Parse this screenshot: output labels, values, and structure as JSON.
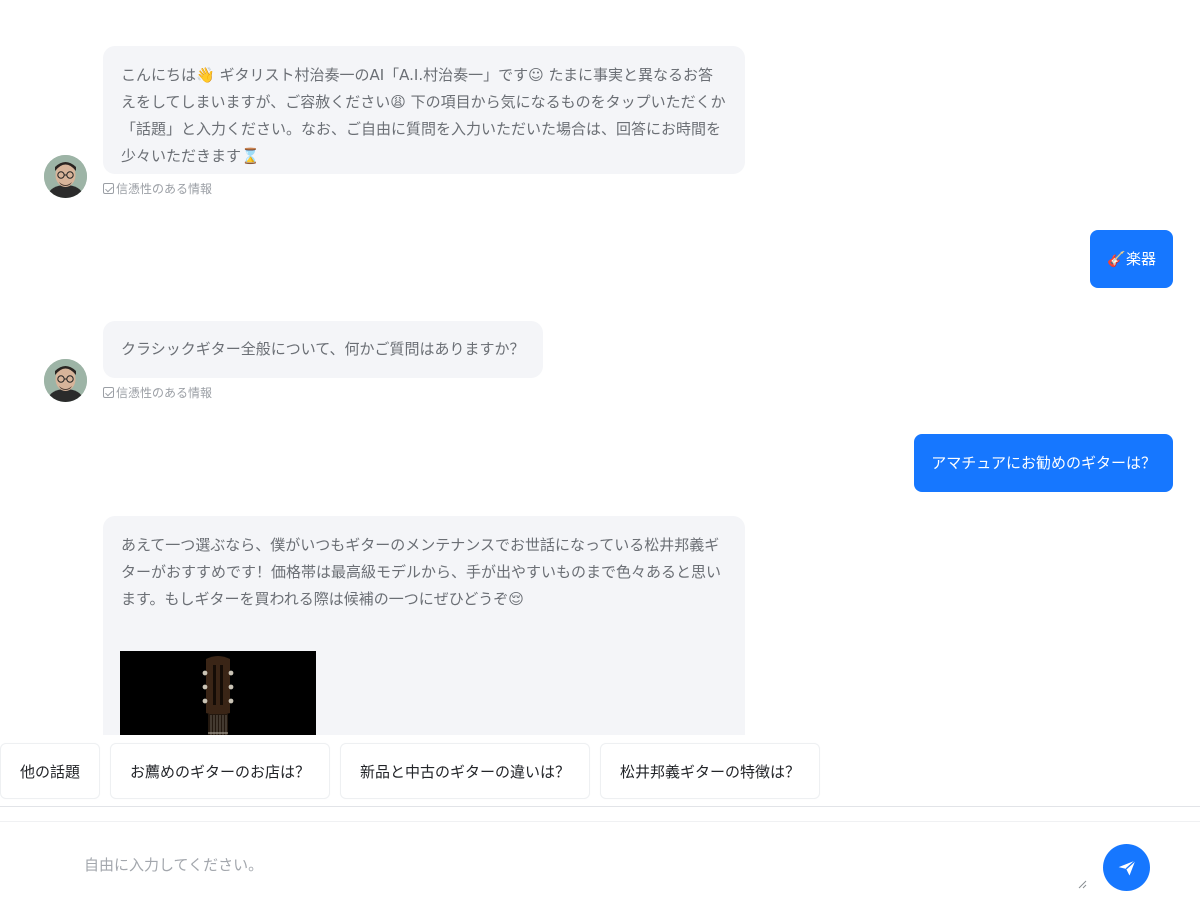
{
  "messages": {
    "bot1": {
      "text": "こんにちは👋 ギタリスト村治奏一のAI「A.I.村治奏一」です☺ たまに事実と異なるお答えをしてしまいますが、ご容赦ください😩 下の項目から気になるものをタップいただくか「話題」と入力ください。なお、ご自由に質問を入力いただいた場合は、回答にお時間を少々いただきます⌛",
      "trust_label": "信憑性のある情報"
    },
    "user1": {
      "text": "🎸楽器"
    },
    "bot2": {
      "text": "クラシックギター全般について、何かご質問はありますか？",
      "trust_label": "信憑性のある情報"
    },
    "user2": {
      "text": "アマチュアにお勧めのギターは？"
    },
    "bot3": {
      "text": "あえて一つ選ぶなら、僕がいつもギターのメンテナンスでお世話になっている松井邦義ギターがおすすめです！価格帯は最高級モデルから、手が出やすいものまで色々あると思います。もしギターを買われる際は候補の一つにぜひどうぞ😌"
    }
  },
  "suggestions": [
    "他の話題",
    "お薦めのギターのお店は？",
    "新品と中古のギターの違いは？",
    "松井邦義ギターの特徴は？"
  ],
  "input": {
    "placeholder": "自由に入力してください。",
    "value": ""
  },
  "colors": {
    "accent": "#1677ff",
    "bot_bubble": "#f4f5f8"
  }
}
